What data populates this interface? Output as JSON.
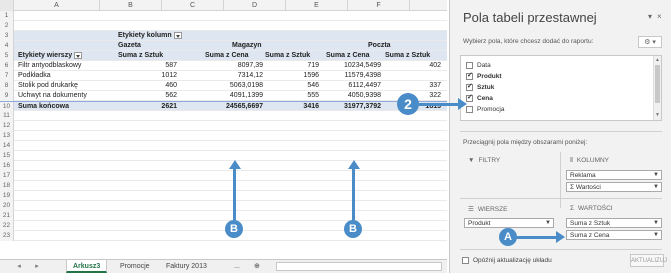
{
  "columns": [
    "A",
    "B",
    "C",
    "D",
    "E",
    "F"
  ],
  "row_numbers": [
    "1",
    "2",
    "3",
    "4",
    "5",
    "6",
    "7",
    "8",
    "9",
    "10",
    "11",
    "12",
    "13",
    "14",
    "15",
    "16",
    "17",
    "18",
    "19",
    "20",
    "21",
    "22",
    "23"
  ],
  "pivot": {
    "col_labels_header": "Etykiety kolumn",
    "group_gazeta": "Gazeta",
    "group_magazyn": "Magazyn",
    "group_poczta": "Poczta",
    "row_labels_header": "Etykiety wierszy",
    "measure_sztuk": "Suma z Sztuk",
    "measure_cena": "Suma z Cena",
    "rows": [
      {
        "label": "Filtr antyodblaskowy",
        "g_sztuk": "587",
        "g_cena": "8097,39",
        "m_sztuk": "719",
        "m_cena": "10234,5499",
        "p_sztuk": "402"
      },
      {
        "label": "Podkładka",
        "g_sztuk": "1012",
        "g_cena": "7314,12",
        "m_sztuk": "1596",
        "m_cena": "11579,4398",
        "p_sztuk": ""
      },
      {
        "label": "Stolik pod drukarkę",
        "g_sztuk": "460",
        "g_cena": "5063,0198",
        "m_sztuk": "546",
        "m_cena": "6112,4497",
        "p_sztuk": "337"
      },
      {
        "label": "Uchwyt na dokumenty",
        "g_sztuk": "562",
        "g_cena": "4091,1399",
        "m_sztuk": "555",
        "m_cena": "4050,9398",
        "p_sztuk": "322"
      }
    ],
    "total": {
      "label": "Suma końcowa",
      "g_sztuk": "2621",
      "g_cena": "24565,6697",
      "m_sztuk": "3416",
      "m_cena": "31977,3792",
      "p_sztuk": "1813"
    }
  },
  "tabs": {
    "prev": "◂",
    "next": "▸",
    "items": [
      "Arkusz3",
      "Promocje",
      "Faktury 2013"
    ],
    "more": "...",
    "add": "⊕"
  },
  "callouts": {
    "b": "B",
    "two": "2",
    "a": "A"
  },
  "pane": {
    "title": "Pola tabeli przestawnej",
    "close": "×",
    "dropdown": "▾",
    "subtitle": "Wybierz pola, które chcesz dodać do raportu:",
    "gear": "⚙ ▾",
    "fields": [
      {
        "label": "Data",
        "checked": false
      },
      {
        "label": "Produkt",
        "checked": true
      },
      {
        "label": "Sztuk",
        "checked": true
      },
      {
        "label": "Cena",
        "checked": true
      },
      {
        "label": "Promocja",
        "checked": false
      }
    ],
    "drag_hint": "Przeciągnij pola między obszarami poniżej:",
    "filters_label": "FILTRY",
    "columns_label": "KOLUMNY",
    "rows_label": "WIERSZE",
    "values_label": "WARTOŚCI",
    "columns_chips": [
      "Reklama",
      "Σ Wartości"
    ],
    "rows_chips": [
      "Produkt"
    ],
    "values_chips": [
      "Suma z Sztuk",
      "Suma z Cena"
    ],
    "defer": "Opóźnij aktualizację układu",
    "update": "AKTUALIZUJ"
  }
}
